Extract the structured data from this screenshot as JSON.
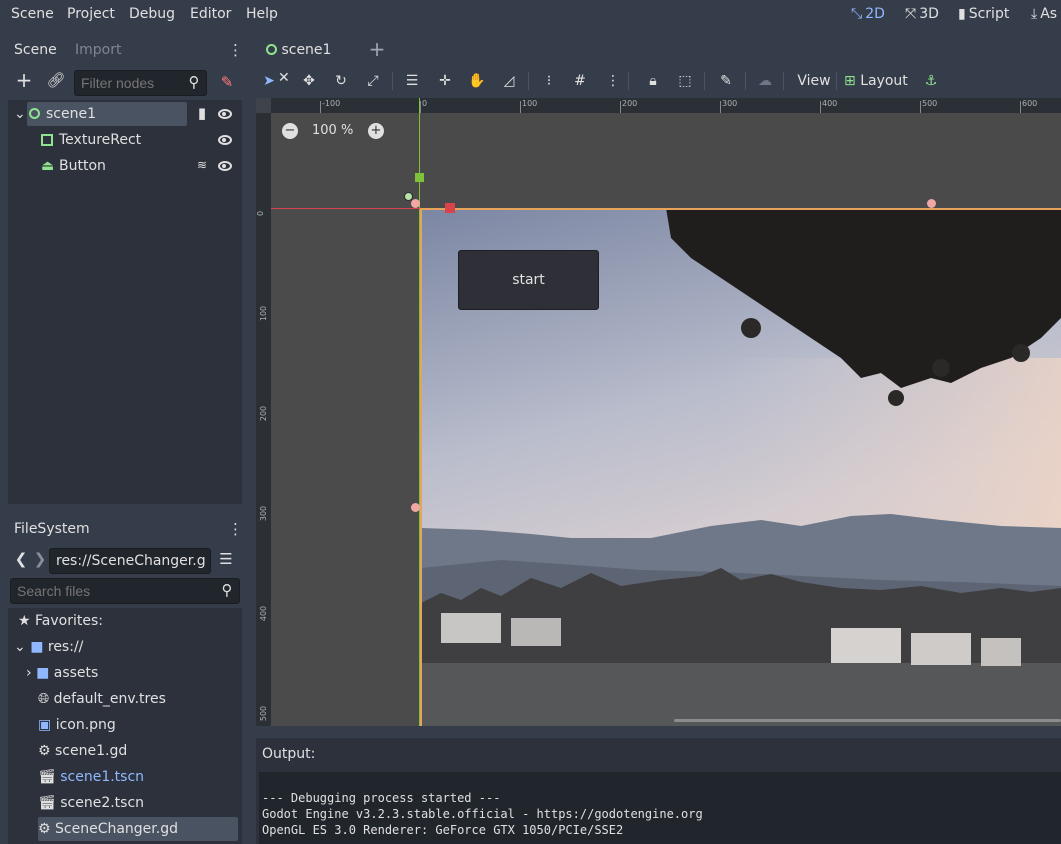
{
  "menubar": {
    "items": [
      "Scene",
      "Project",
      "Debug",
      "Editor",
      "Help"
    ],
    "modes": [
      {
        "label": "2D",
        "icon": "2d-icon",
        "active": true
      },
      {
        "label": "3D",
        "icon": "3d-icon",
        "active": false
      },
      {
        "label": "Script",
        "icon": "script-icon",
        "active": false
      },
      {
        "label": "As",
        "icon": "assetlib-icon",
        "active": false
      }
    ]
  },
  "scene_dock": {
    "tabs": [
      "Scene",
      "Import"
    ],
    "filter_placeholder": "Filter nodes",
    "nodes": [
      {
        "name": "scene1",
        "icon": "node-icon",
        "selected": true
      },
      {
        "name": "TextureRect",
        "icon": "texturerect-icon"
      },
      {
        "name": "Button",
        "icon": "button-icon"
      }
    ]
  },
  "filesystem_dock": {
    "tab": "FileSystem",
    "path": "res://SceneChanger.g",
    "search_placeholder": "Search files",
    "items": [
      {
        "label": "Favorites:",
        "icon": "star-icon"
      },
      {
        "label": "res://",
        "icon": "folder-icon"
      },
      {
        "label": "assets",
        "icon": "folder-icon"
      },
      {
        "label": "default_env.tres",
        "icon": "globe-icon"
      },
      {
        "label": "icon.png",
        "icon": "image-icon"
      },
      {
        "label": "scene1.gd",
        "icon": "gear-icon"
      },
      {
        "label": "scene1.tscn",
        "icon": "clapper-icon",
        "highlight": true
      },
      {
        "label": "scene2.tscn",
        "icon": "clapper-icon"
      },
      {
        "label": "SceneChanger.gd",
        "icon": "gear-icon",
        "selected": true
      }
    ]
  },
  "editor": {
    "scene_tab": "scene1",
    "toolbar": {
      "view_label": "View",
      "layout_label": "Layout"
    },
    "zoom": "100 %",
    "ruler_top": [
      "-100",
      "0",
      "100",
      "200",
      "300",
      "400",
      "500",
      "600"
    ],
    "ruler_left": [
      "0",
      "100",
      "200",
      "300",
      "400",
      "500"
    ],
    "button_text": "start"
  },
  "output": {
    "label": "Output:",
    "lines": [
      "--- Debugging process started ---",
      "Godot Engine v3.2.3.stable.official - https://godotengine.org",
      "OpenGL ES 3.0 Renderer: GeForce GTX 1050/PCIe/SSE2"
    ]
  },
  "colors": {
    "accent": "#8fb8ff",
    "background": "#363d4a",
    "panel": "#2c313b"
  }
}
